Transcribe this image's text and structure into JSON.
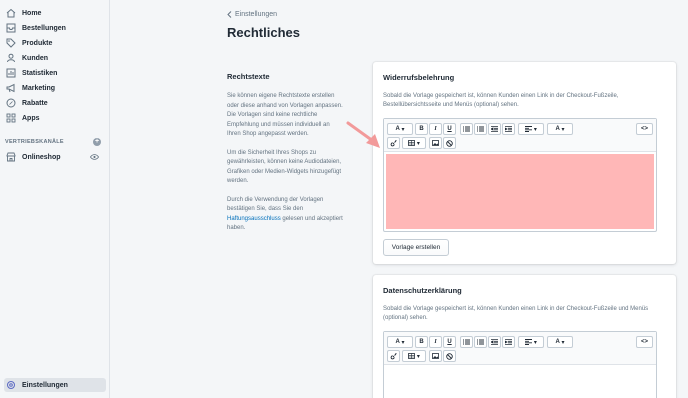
{
  "sidebar": {
    "items": [
      {
        "label": "Home",
        "icon": "home-icon"
      },
      {
        "label": "Bestellungen",
        "icon": "orders-icon"
      },
      {
        "label": "Produkte",
        "icon": "tag-icon"
      },
      {
        "label": "Kunden",
        "icon": "user-icon"
      },
      {
        "label": "Statistiken",
        "icon": "chart-icon"
      },
      {
        "label": "Marketing",
        "icon": "megaphone-icon"
      },
      {
        "label": "Rabatte",
        "icon": "discount-icon"
      },
      {
        "label": "Apps",
        "icon": "apps-icon"
      }
    ],
    "section_title": "VERTRIEBSKANÄLE",
    "section_add": "+",
    "channel": {
      "label": "Onlineshop",
      "icon": "store-icon"
    },
    "settings": {
      "label": "Einstellungen",
      "icon": "gear-icon"
    }
  },
  "header": {
    "breadcrumb": "Einstellungen",
    "title": "Rechtliches"
  },
  "left": {
    "heading": "Rechtstexte",
    "p1": "Sie können eigene Rechtstexte erstellen oder diese anhand von Vorlagen anpassen. Die Vorlagen sind keine rechtliche Empfehlung und müssen individuell an Ihren Shop angepasst werden.",
    "p2": "Um die Sicherheit Ihres Shops zu gewährleisten, können keine Audiodateien, Grafiken oder Medien-Widgets hinzugefügt werden.",
    "p3_before": "Durch die Verwendung der Vorlagen bestätigen Sie, dass Sie den ",
    "p3_link": "Haftungsausschluss",
    "p3_after": " gelesen und akzeptiert haben."
  },
  "cards": [
    {
      "title": "Widerrufsbelehrung",
      "desc": "Sobald die Vorlage gespeichert ist, können Kunden einen Link in der Checkout-Fußzeile, Bestellübersichtsseite und Menüs (optional) sehen.",
      "button": "Vorlage erstellen"
    },
    {
      "title": "Datenschutzerklärung",
      "desc": "Sobald die Vorlage gespeichert ist, können Kunden einen Link in der Checkout-Fußzeile und Menüs (optional) sehen."
    }
  ],
  "toolbar": {
    "font": "A",
    "bold": "B",
    "italic": "I",
    "underline": "U",
    "color": "A",
    "code": "<>"
  },
  "colors": {
    "highlight": "#ffb7b7",
    "arrow": "#f29a9a",
    "link": "#006fbb"
  }
}
